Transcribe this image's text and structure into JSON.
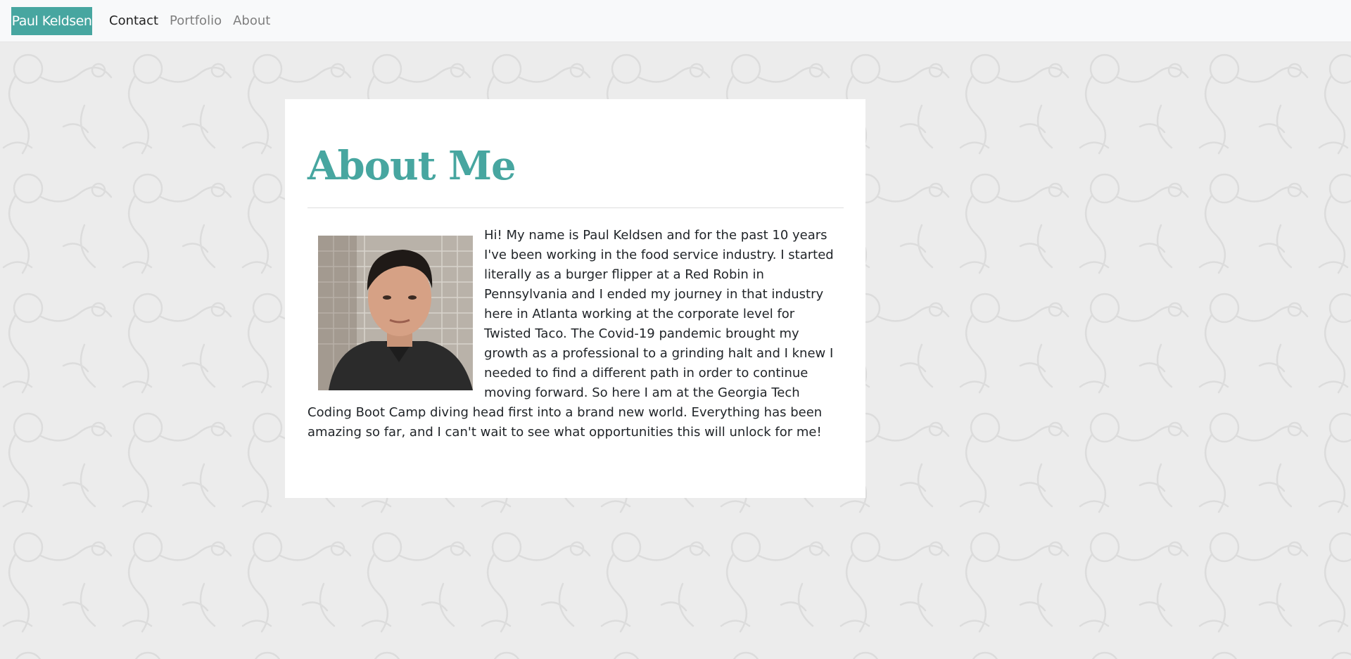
{
  "navbar": {
    "brand": "Paul Keldsen",
    "links": [
      {
        "label": "Contact",
        "active": true
      },
      {
        "label": "Portfolio",
        "active": false
      },
      {
        "label": "About",
        "active": false
      }
    ]
  },
  "about": {
    "title": "About Me",
    "bio": "Hi! My name is Paul Keldsen and for the past 10 years I've been working in the food service industry. I started literally as a burger flipper at a Red Robin in Pennsylvania and I ended my journey in that industry here in Atlanta working at the corporate level for Twisted Taco. The Covid-19 pandemic brought my growth as a professional to a grinding halt and I knew I needed to find a different path in order to continue moving forward. So here I am at the Georgia Tech Coding Boot Camp diving head first into a brand new world. Everything has been amazing so far, and I can't wait to see what opportunities this will unlock for me!"
  },
  "colors": {
    "accent": "#47a6a0",
    "navbar_bg": "#f8f9fa",
    "page_bg": "#ececec"
  }
}
